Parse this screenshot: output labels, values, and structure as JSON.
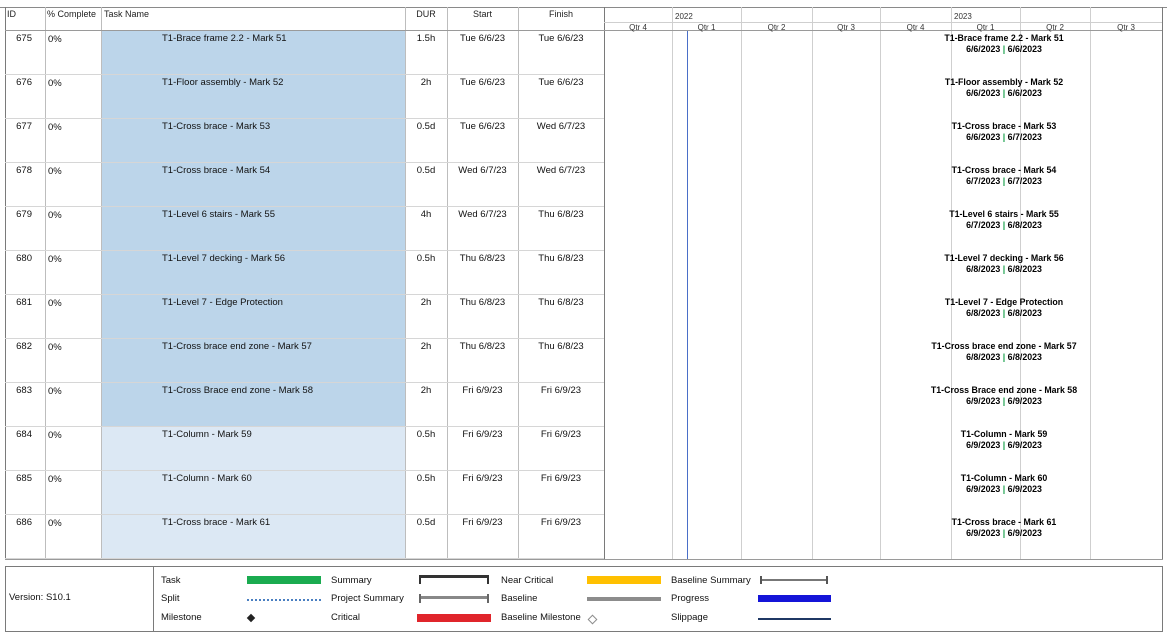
{
  "columns": {
    "id": "ID",
    "percent_complete": "% Complete",
    "task_name": "Task Name",
    "duration": "DUR",
    "start": "Start",
    "finish": "Finish"
  },
  "timeline": {
    "years": [
      "2022",
      "2023"
    ],
    "quarters": [
      "Qtr 4",
      "Qtr 1",
      "Qtr 2",
      "Qtr 3",
      "Qtr 4",
      "Qtr 1",
      "Qtr 2",
      "Qtr 3"
    ]
  },
  "tasks": [
    {
      "id": "675",
      "pct": "0%",
      "name": "T1-Brace frame 2.2 - Mark 51",
      "dur": "1.5h",
      "start": "Tue 6/6/23",
      "finish": "Tue 6/6/23",
      "bar_start": "6/6/2023",
      "bar_finish": "6/6/2023"
    },
    {
      "id": "676",
      "pct": "0%",
      "name": "T1-Floor assembly - Mark 52",
      "dur": "2h",
      "start": "Tue 6/6/23",
      "finish": "Tue 6/6/23",
      "bar_start": "6/6/2023",
      "bar_finish": "6/6/2023"
    },
    {
      "id": "677",
      "pct": "0%",
      "name": "T1-Cross brace - Mark 53",
      "dur": "0.5d",
      "start": "Tue 6/6/23",
      "finish": "Wed 6/7/23",
      "bar_start": "6/6/2023",
      "bar_finish": "6/7/2023"
    },
    {
      "id": "678",
      "pct": "0%",
      "name": "T1-Cross brace - Mark 54",
      "dur": "0.5d",
      "start": "Wed 6/7/23",
      "finish": "Wed 6/7/23",
      "bar_start": "6/7/2023",
      "bar_finish": "6/7/2023"
    },
    {
      "id": "679",
      "pct": "0%",
      "name": "T1-Level 6 stairs - Mark 55",
      "dur": "4h",
      "start": "Wed 6/7/23",
      "finish": "Thu 6/8/23",
      "bar_start": "6/7/2023",
      "bar_finish": "6/8/2023"
    },
    {
      "id": "680",
      "pct": "0%",
      "name": "T1-Level 7 decking - Mark 56",
      "dur": "0.5h",
      "start": "Thu 6/8/23",
      "finish": "Thu 6/8/23",
      "bar_start": "6/8/2023",
      "bar_finish": "6/8/2023"
    },
    {
      "id": "681",
      "pct": "0%",
      "name": "T1-Level 7 - Edge Protection",
      "dur": "2h",
      "start": "Thu 6/8/23",
      "finish": "Thu 6/8/23",
      "bar_start": "6/8/2023",
      "bar_finish": "6/8/2023"
    },
    {
      "id": "682",
      "pct": "0%",
      "name": "T1-Cross brace end zone - Mark 57",
      "dur": "2h",
      "start": "Thu 6/8/23",
      "finish": "Thu 6/8/23",
      "bar_start": "6/8/2023",
      "bar_finish": "6/8/2023"
    },
    {
      "id": "683",
      "pct": "0%",
      "name": "T1-Cross Brace end zone - Mark 58",
      "dur": "2h",
      "start": "Fri 6/9/23",
      "finish": "Fri 6/9/23",
      "bar_start": "6/9/2023",
      "bar_finish": "6/9/2023"
    },
    {
      "id": "684",
      "pct": "0%",
      "name": "T1-Column - Mark 59",
      "dur": "0.5h",
      "start": "Fri 6/9/23",
      "finish": "Fri 6/9/23",
      "bar_start": "6/9/2023",
      "bar_finish": "6/9/2023"
    },
    {
      "id": "685",
      "pct": "0%",
      "name": "T1-Column - Mark 60",
      "dur": "0.5h",
      "start": "Fri 6/9/23",
      "finish": "Fri 6/9/23",
      "bar_start": "6/9/2023",
      "bar_finish": "6/9/2023"
    },
    {
      "id": "686",
      "pct": "0%",
      "name": "T1-Cross brace - Mark 61",
      "dur": "0.5d",
      "start": "Fri 6/9/23",
      "finish": "Fri 6/9/23",
      "bar_start": "6/9/2023",
      "bar_finish": "6/9/2023"
    }
  ],
  "legend": {
    "version": "Version: S10.1",
    "items": [
      {
        "label": "Task",
        "symbol": "task-bar-icon",
        "color": "#1aab50"
      },
      {
        "label": "Split",
        "symbol": "split-dotted-icon",
        "color": "#4a7fc1"
      },
      {
        "label": "Milestone",
        "symbol": "milestone-diamond-icon",
        "color": "#222222"
      },
      {
        "label": "Summary",
        "symbol": "summary-bracket-icon",
        "color": "#333333"
      },
      {
        "label": "Project Summary",
        "symbol": "project-summary-bracket-icon",
        "color": "#888888"
      },
      {
        "label": "Critical",
        "symbol": "critical-bar-icon",
        "color": "#e0252b"
      },
      {
        "label": "Near Critical",
        "symbol": "near-critical-bar-icon",
        "color": "#ffc000"
      },
      {
        "label": "Baseline",
        "symbol": "baseline-bar-icon",
        "color": "#8c8c8c"
      },
      {
        "label": "Baseline Milestone",
        "symbol": "baseline-milestone-icon",
        "color": "#8c8c8c"
      },
      {
        "label": "Baseline Summary",
        "symbol": "baseline-summary-bracket-icon",
        "color": "#777777"
      },
      {
        "label": "Progress",
        "symbol": "progress-bar-icon",
        "color": "#1414d8"
      },
      {
        "label": "Slippage",
        "symbol": "slippage-line-icon",
        "color": "#1f3864"
      }
    ]
  },
  "colors": {
    "row_highlight": "#bcd5ea",
    "row_highlight_light": "#dce8f4",
    "today_line": "#4a6fc8",
    "date_separator": "#18a04a"
  }
}
